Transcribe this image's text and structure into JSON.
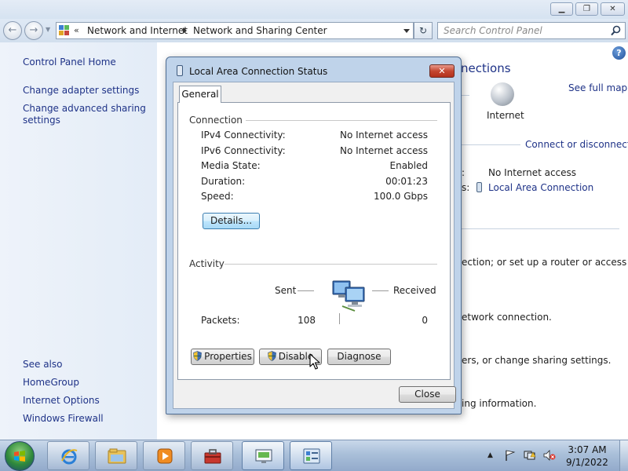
{
  "window": {
    "minimize_glyph": "▁",
    "maximize_glyph": "❐",
    "close_glyph": "✕"
  },
  "navigation": {
    "back_glyph": "←",
    "forward_glyph": "→",
    "chevron": "«",
    "breadcrumbs": [
      "Network and Internet",
      "Network and Sharing Center"
    ],
    "refresh_glyph": "↻",
    "search_placeholder": "Search Control Panel"
  },
  "sidebar": {
    "home": "Control Panel Home",
    "links": [
      "Change adapter settings",
      "Change advanced sharing",
      "settings"
    ],
    "see_also_label": "See also",
    "see_also": [
      "HomeGroup",
      "Internet Options",
      "Windows Firewall"
    ]
  },
  "main": {
    "heading_partial": "nections",
    "see_full_map": "See full map",
    "internet_label": "Internet",
    "connect_disconnect": "Connect or disconnect",
    "access_type_colon": ":",
    "access_type_value": "No Internet access",
    "connections_colon": "s:",
    "connections_value": "Local Area Connection",
    "desc_1": "ection; or set up a router or access",
    "desc_2": "etwork connection.",
    "desc_3": "ers, or change sharing settings.",
    "desc_4": "ing information."
  },
  "dialog": {
    "title": "Local Area Connection Status",
    "close_glyph": "✕",
    "tab": "General",
    "connection_group": "Connection",
    "rows": [
      {
        "label": "IPv4 Connectivity:",
        "value": "No Internet access"
      },
      {
        "label": "IPv6 Connectivity:",
        "value": "No Internet access"
      },
      {
        "label": "Media State:",
        "value": "Enabled"
      },
      {
        "label": "Duration:",
        "value": "00:01:23"
      },
      {
        "label": "Speed:",
        "value": "100.0 Gbps"
      }
    ],
    "details_button": "Details...",
    "activity_group": "Activity",
    "sent_label": "Sent",
    "received_label": "Received",
    "packets_label": "Packets:",
    "packets_sent": "108",
    "packets_received": "0",
    "properties_button": "Properties",
    "disable_button": "Disable",
    "diagnose_button": "Diagnose",
    "close_button": "Close"
  },
  "taskbar": {
    "apps": [
      "internet-explorer",
      "windows-explorer",
      "media-player",
      "control-panel-tools",
      "network-connections",
      "control-panel"
    ],
    "time": "3:07 AM",
    "date": "9/1/2022",
    "tray_up_glyph": "▲"
  },
  "colors": {
    "link": "#1e3287",
    "dialog_frame": "#bfd3ea",
    "taskbar": "#a9bfd9",
    "close_red": "#c44731"
  }
}
